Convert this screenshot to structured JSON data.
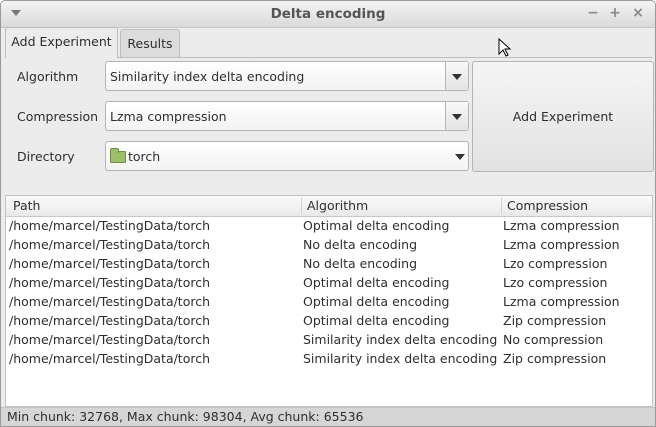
{
  "window": {
    "title": "Delta encoding"
  },
  "tabs": [
    {
      "label": "Add Experiment"
    },
    {
      "label": "Results"
    }
  ],
  "form": {
    "algorithm_label": "Algorithm",
    "algorithm_value": "Similarity index delta encoding",
    "compression_label": "Compression",
    "compression_value": "Lzma compression",
    "directory_label": "Directory",
    "directory_value": "torch",
    "add_button_label": "Add Experiment"
  },
  "table": {
    "columns": [
      "Path",
      "Algorithm",
      "Compression"
    ],
    "rows": [
      [
        "/home/marcel/TestingData/torch",
        "Optimal delta encoding",
        "Lzma compression"
      ],
      [
        "/home/marcel/TestingData/torch",
        "No delta encoding",
        "Lzma compression"
      ],
      [
        "/home/marcel/TestingData/torch",
        "No delta encoding",
        "Lzo compression"
      ],
      [
        "/home/marcel/TestingData/torch",
        "Optimal delta encoding",
        "Lzo compression"
      ],
      [
        "/home/marcel/TestingData/torch",
        "Optimal delta encoding",
        "Lzma compression"
      ],
      [
        "/home/marcel/TestingData/torch",
        "Optimal delta encoding",
        "Zip compression"
      ],
      [
        "/home/marcel/TestingData/torch",
        "Similarity index delta encoding",
        "No compression"
      ],
      [
        "/home/marcel/TestingData/torch",
        "Similarity index delta encoding",
        "Zip compression"
      ]
    ]
  },
  "status_bar": {
    "text": "Min chunk: 32768, Max chunk: 98304, Avg chunk: 65536"
  },
  "icons": {
    "folder": "folder-icon",
    "window_menu": "chevron-down-icon",
    "minimize": "minimize-icon",
    "maximize": "maximize-icon",
    "close": "close-icon",
    "cursor": "mouse-pointer-icon"
  }
}
